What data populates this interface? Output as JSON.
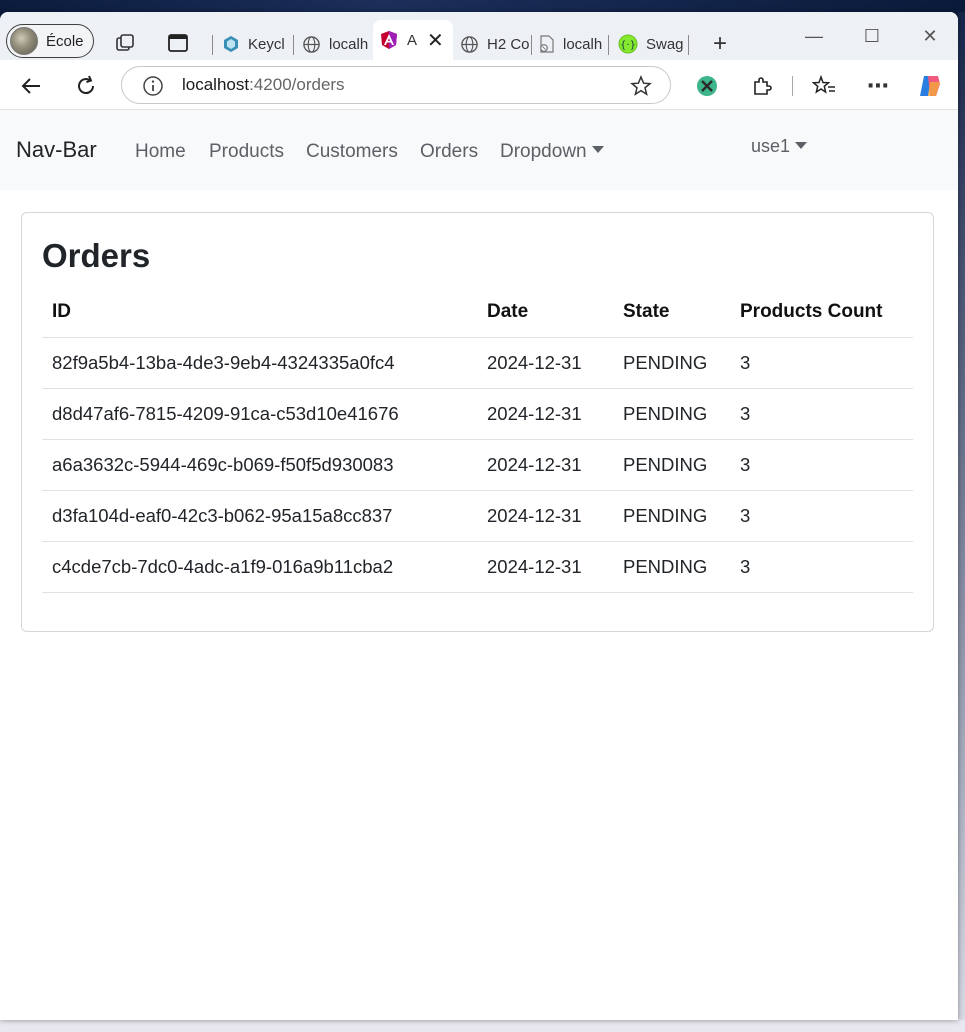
{
  "browser": {
    "profile_name": "École",
    "tabs": [
      {
        "label": "Keycl",
        "icon": "keycloak-icon"
      },
      {
        "label": "localh",
        "icon": "globe-icon"
      },
      {
        "label": "A",
        "icon": "angular-icon",
        "active": true
      },
      {
        "label": "H2 Co",
        "icon": "globe-icon"
      },
      {
        "label": "localh",
        "icon": "file-error-icon"
      },
      {
        "label": "Swag",
        "icon": "swagger-icon"
      }
    ],
    "url_host": "localhost",
    "url_rest": ":4200/orders"
  },
  "navbar": {
    "brand": "Nav-Bar",
    "links": [
      "Home",
      "Products",
      "Customers",
      "Orders"
    ],
    "dropdown": "Dropdown",
    "user": "use1"
  },
  "orders": {
    "title": "Orders",
    "columns": [
      "ID",
      "Date",
      "State",
      "Products Count"
    ],
    "rows": [
      [
        "82f9a5b4-13ba-4de3-9eb4-4324335a0fc4",
        "2024-12-31",
        "PENDING",
        "3"
      ],
      [
        "d8d47af6-7815-4209-91ca-c53d10e41676",
        "2024-12-31",
        "PENDING",
        "3"
      ],
      [
        "a6a3632c-5944-469c-b069-f50f5d930083",
        "2024-12-31",
        "PENDING",
        "3"
      ],
      [
        "d3fa104d-eaf0-42c3-b062-95a15a8cc837",
        "2024-12-31",
        "PENDING",
        "3"
      ],
      [
        "c4cde7cb-7dc0-4adc-a1f9-016a9b11cba2",
        "2024-12-31",
        "PENDING",
        "3"
      ]
    ]
  }
}
